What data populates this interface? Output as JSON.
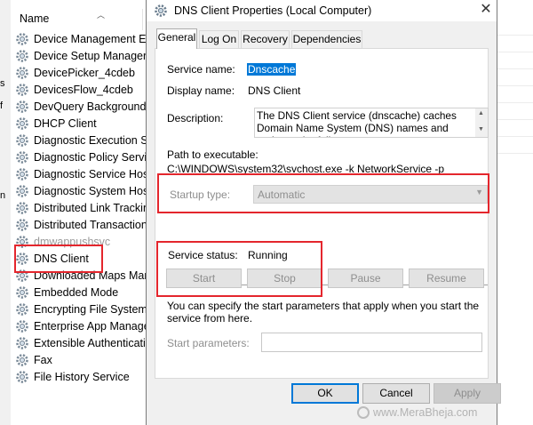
{
  "services_list": {
    "column_header": "Name",
    "left_strip_fragments": [
      "s",
      "f",
      "n"
    ],
    "rows": [
      {
        "label": "Device Management Enr",
        "dim": false
      },
      {
        "label": "Device Setup Manager",
        "dim": false
      },
      {
        "label": "DevicePicker_4cdeb",
        "dim": false
      },
      {
        "label": "DevicesFlow_4cdeb",
        "dim": false
      },
      {
        "label": "DevQuery Background D",
        "dim": false
      },
      {
        "label": "DHCP Client",
        "dim": false
      },
      {
        "label": "Diagnostic Execution Ser",
        "dim": false
      },
      {
        "label": "Diagnostic Policy Service",
        "dim": false
      },
      {
        "label": "Diagnostic Service Host",
        "dim": false
      },
      {
        "label": "Diagnostic System Host",
        "dim": false
      },
      {
        "label": "Distributed Link Tracking",
        "dim": false
      },
      {
        "label": "Distributed Transaction C",
        "dim": false
      },
      {
        "label": "dmwappushsvc",
        "dim": true
      },
      {
        "label": "DNS Client",
        "dim": false
      },
      {
        "label": "Downloaded Maps Mana",
        "dim": false
      },
      {
        "label": "Embedded Mode",
        "dim": false
      },
      {
        "label": "Encrypting File System (",
        "dim": false
      },
      {
        "label": "Enterprise App Manager",
        "dim": false
      },
      {
        "label": "Extensible Authentication",
        "dim": false
      },
      {
        "label": "Fax",
        "dim": false
      },
      {
        "label": "File History Service",
        "dim": false
      }
    ]
  },
  "dialog": {
    "title": "DNS Client Properties (Local Computer)",
    "close_glyph": "✕",
    "tabs": [
      "General",
      "Log On",
      "Recovery",
      "Dependencies"
    ],
    "general": {
      "service_name_label": "Service name:",
      "service_name_value": "Dnscache",
      "display_name_label": "Display name:",
      "display_name_value": "DNS Client",
      "description_label": "Description:",
      "description_value": "The DNS Client service (dnscache) caches Domain Name System (DNS) names and registers the full",
      "path_label": "Path to executable:",
      "path_value": "C:\\WINDOWS\\system32\\svchost.exe -k NetworkService -p",
      "startup_type_label": "Startup type:",
      "startup_type_value": "Automatic",
      "service_status_label": "Service status:",
      "service_status_value": "Running",
      "buttons": {
        "start": "Start",
        "stop": "Stop",
        "pause": "Pause",
        "resume": "Resume"
      },
      "hint": "You can specify the start parameters that apply when you start the service from here.",
      "start_params_label": "Start parameters:",
      "start_params_value": ""
    },
    "footer": {
      "ok": "OK",
      "cancel": "Cancel",
      "apply": "Apply"
    }
  },
  "watermark": "www.MeraBheja.com",
  "colors": {
    "highlight_red": "#e4262d",
    "selection_blue": "#0078d7",
    "dialog_bg": "#f0f0f0"
  }
}
